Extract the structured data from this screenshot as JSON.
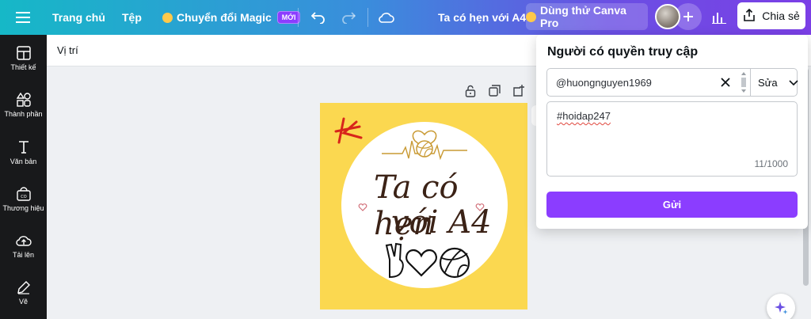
{
  "topbar": {
    "home": "Trang chủ",
    "file": "Tệp",
    "magic_switch": "Chuyển đổi Magic",
    "new_badge": "MỚI",
    "doc_title": "Ta có hẹn với A4",
    "try_pro": "Dùng thử Canva Pro",
    "share": "Chia sẻ"
  },
  "sidebar": {
    "items": [
      {
        "label": "Thiết kế",
        "icon": "layout-icon"
      },
      {
        "label": "Thành phần",
        "icon": "shapes-icon"
      },
      {
        "label": "Văn bản",
        "icon": "text-icon"
      },
      {
        "label": "Thương hiệu",
        "icon": "brand-icon"
      },
      {
        "label": "Tải lên",
        "icon": "upload-icon"
      },
      {
        "label": "Vẽ",
        "icon": "pen-icon"
      }
    ]
  },
  "context_bar": {
    "position_label": "Vị trí"
  },
  "design": {
    "line1": "Ta có hẹn",
    "line2": "với A4",
    "signature_mark": "K"
  },
  "share_panel": {
    "title": "Người có quyền truy cập",
    "recipient": "@huongnguyen1969",
    "permission": "Sửa",
    "message": "#hoidap247",
    "char_count": "11/1000",
    "send": "Gửi"
  },
  "colors": {
    "accent_purple": "#8b3dff",
    "page_yellow": "#fbd850",
    "sidebar_bg": "#18191b"
  }
}
